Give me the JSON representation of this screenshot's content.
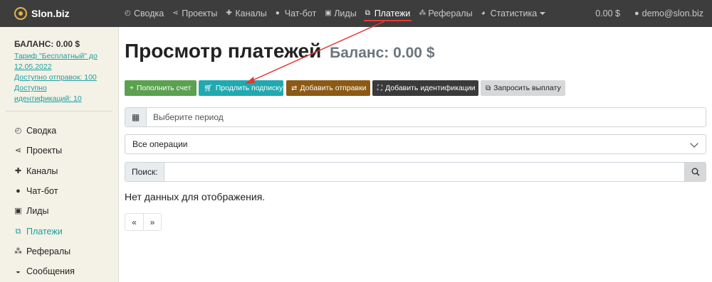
{
  "brand": {
    "name": "Slon.biz"
  },
  "nav": {
    "items": [
      {
        "label": "Сводка",
        "icon": "dashboard-icon"
      },
      {
        "label": "Проекты",
        "icon": "share-icon"
      },
      {
        "label": "Каналы",
        "icon": "puzzle-icon"
      },
      {
        "label": "Чат-бот",
        "icon": "chat-icon"
      },
      {
        "label": "Лиды",
        "icon": "contact-card-icon"
      },
      {
        "label": "Платежи",
        "icon": "payments-icon",
        "active": true
      },
      {
        "label": "Рефералы",
        "icon": "sitemap-icon"
      },
      {
        "label": "Статистика",
        "icon": "pie-chart-icon"
      }
    ],
    "balance": "0.00 $",
    "user": "demo@slon.biz"
  },
  "sidebar": {
    "balance": "БАЛАНС: 0.00 $",
    "tariff_line1": "Тариф \"Бесплатный\" до",
    "tariff_line2": "12.05.2022",
    "sends_available": "Доступно отправок: 100",
    "ident_line1": "Доступно",
    "ident_line2": "идентификаций: 10",
    "items": [
      {
        "label": "Сводка",
        "icon": "dashboard-icon"
      },
      {
        "label": "Проекты",
        "icon": "share-icon"
      },
      {
        "label": "Каналы",
        "icon": "puzzle-icon"
      },
      {
        "label": "Чат-бот",
        "icon": "chat-icon"
      },
      {
        "label": "Лиды",
        "icon": "contact-card-icon"
      },
      {
        "label": "Платежи",
        "icon": "payments-icon",
        "active": true
      },
      {
        "label": "Рефералы",
        "icon": "sitemap-icon"
      },
      {
        "label": "Сообщения",
        "icon": "inbox-icon"
      }
    ]
  },
  "main": {
    "title": "Просмотр платежей",
    "subtitle": "Баланс: 0.00 $",
    "buttons": {
      "topup": "Пополнить счет",
      "extend": "Продлить подписку",
      "add_sends": "Добавить отправки",
      "add_ident": "Добавить идентификации",
      "payout": "Запросить выплату"
    },
    "period_placeholder": "Выберите период",
    "operations_selected": "Все операции",
    "search_label": "Поиск:",
    "no_data": "Нет данных для отображения.",
    "pager": {
      "prev": "«",
      "next": "»"
    }
  },
  "colors": {
    "topnav_bg": "#3d3d3d",
    "sidebar_bg": "#f4f1e6",
    "accent_teal": "#1aa0a0",
    "annotation_red": "#e53935",
    "btn_green": "#5ba150",
    "btn_teal": "#20a9b0",
    "btn_brown": "#8c5a14",
    "btn_dark": "#3a3a3a",
    "btn_gray": "#d6d8da"
  }
}
